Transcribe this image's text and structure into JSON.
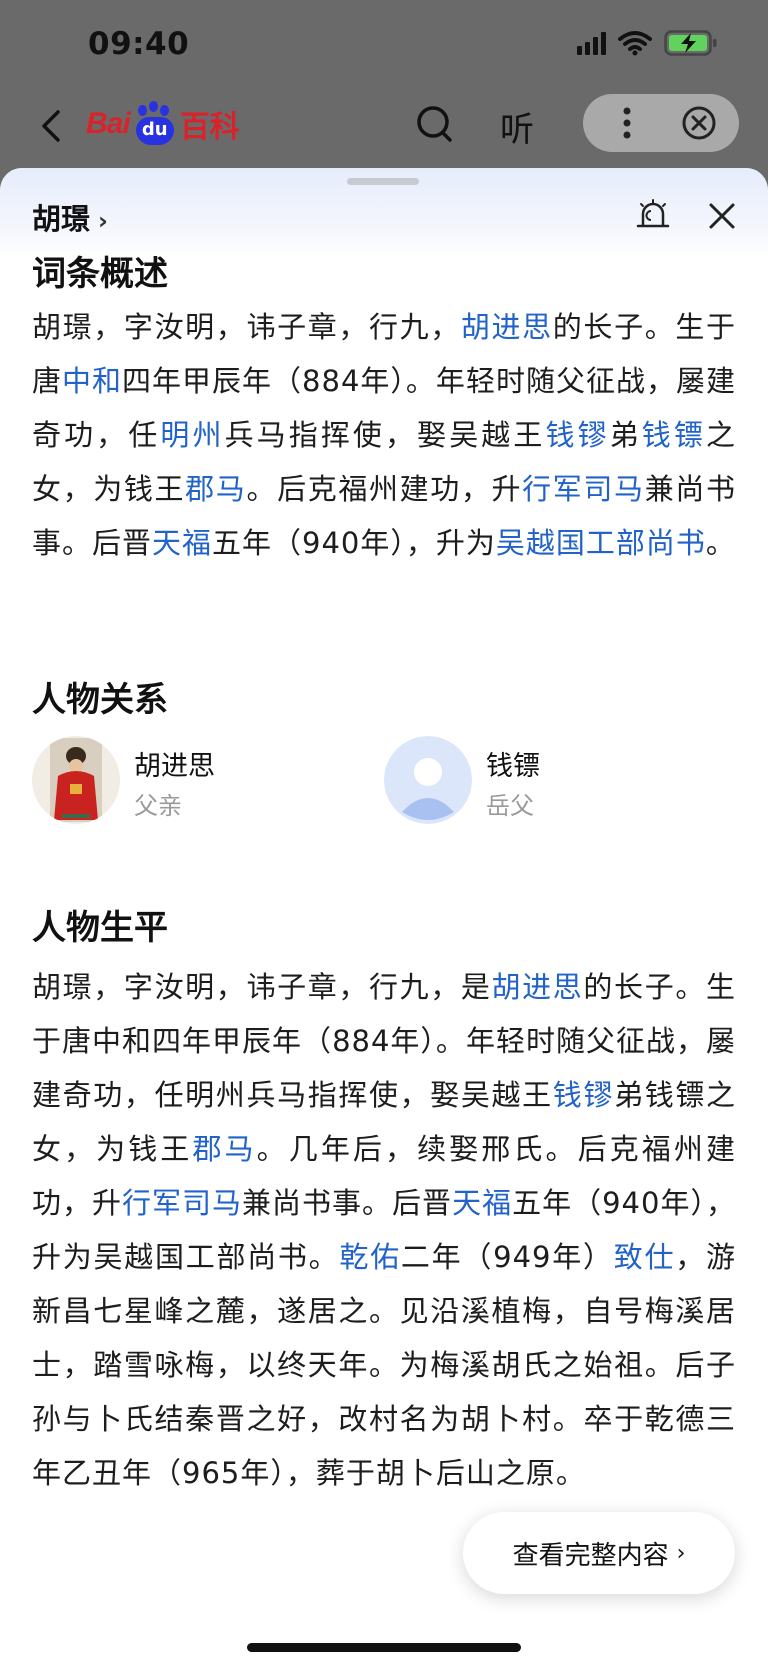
{
  "status_bar": {
    "time": "09:40"
  },
  "browser": {
    "logo_left": "Bai",
    "logo_du": "du",
    "logo_right": "百科",
    "listen_label": "听"
  },
  "sheet": {
    "entry_title": "胡璟"
  },
  "overview": {
    "heading": "词条概述",
    "segments": [
      {
        "t": "胡璟，字汝明，讳子章，行九，"
      },
      {
        "t": "胡进思",
        "link": true
      },
      {
        "t": "的长子。生于唐"
      },
      {
        "t": "中和",
        "link": true
      },
      {
        "t": "四年甲辰年（884年）。年轻时随父征战，屡建奇功，任"
      },
      {
        "t": "明州",
        "link": true
      },
      {
        "t": "兵马指挥使，娶吴越王"
      },
      {
        "t": "钱镠",
        "link": true
      },
      {
        "t": "弟"
      },
      {
        "t": "钱镖",
        "link": true
      },
      {
        "t": "之女，为钱王"
      },
      {
        "t": "郡马",
        "link": true
      },
      {
        "t": "。后克福州建功，升"
      },
      {
        "t": "行军司马",
        "link": true
      },
      {
        "t": "兼尚书事。后晋"
      },
      {
        "t": "天福",
        "link": true
      },
      {
        "t": "五年（940年），升为"
      },
      {
        "t": "吴越国工部尚书",
        "link": true
      },
      {
        "t": "。"
      }
    ]
  },
  "relations": {
    "heading": "人物关系",
    "items": [
      {
        "name": "胡进思",
        "role": "父亲"
      },
      {
        "name": "钱镖",
        "role": "岳父"
      }
    ]
  },
  "biography": {
    "heading": "人物生平",
    "segments": [
      {
        "t": "胡璟，字汝明，讳子章，行九，是"
      },
      {
        "t": "胡进思",
        "link": true
      },
      {
        "t": "的长子。生于唐中和四年甲辰年（884年）。年轻时随父征战，屡建奇功，任明州兵马指挥使，娶吴越王"
      },
      {
        "t": "钱镠",
        "link": true
      },
      {
        "t": "弟钱镖之女，为钱王"
      },
      {
        "t": "郡马",
        "link": true
      },
      {
        "t": "。几年后，续娶邢氏。后克福州建功，升"
      },
      {
        "t": "行军司马",
        "link": true
      },
      {
        "t": "兼尚书事。后晋"
      },
      {
        "t": "天福",
        "link": true
      },
      {
        "t": "五年（940年），升为吴越国工部尚书。"
      },
      {
        "t": "乾佑",
        "link": true
      },
      {
        "t": "二年（949年）"
      },
      {
        "t": "致仕",
        "link": true
      },
      {
        "t": "，游新昌七星峰之麓，遂居之。见沿溪植梅，自号梅溪居士，踏雪咏梅，以终天年。为梅溪胡氏之始祖。后子孙与卜氏结秦晋之好，改村名为胡卜村。卒于乾德三年乙丑年（965年），葬于胡卜后山之原。"
      }
    ]
  },
  "view_full": {
    "label": "查看完整内容"
  }
}
